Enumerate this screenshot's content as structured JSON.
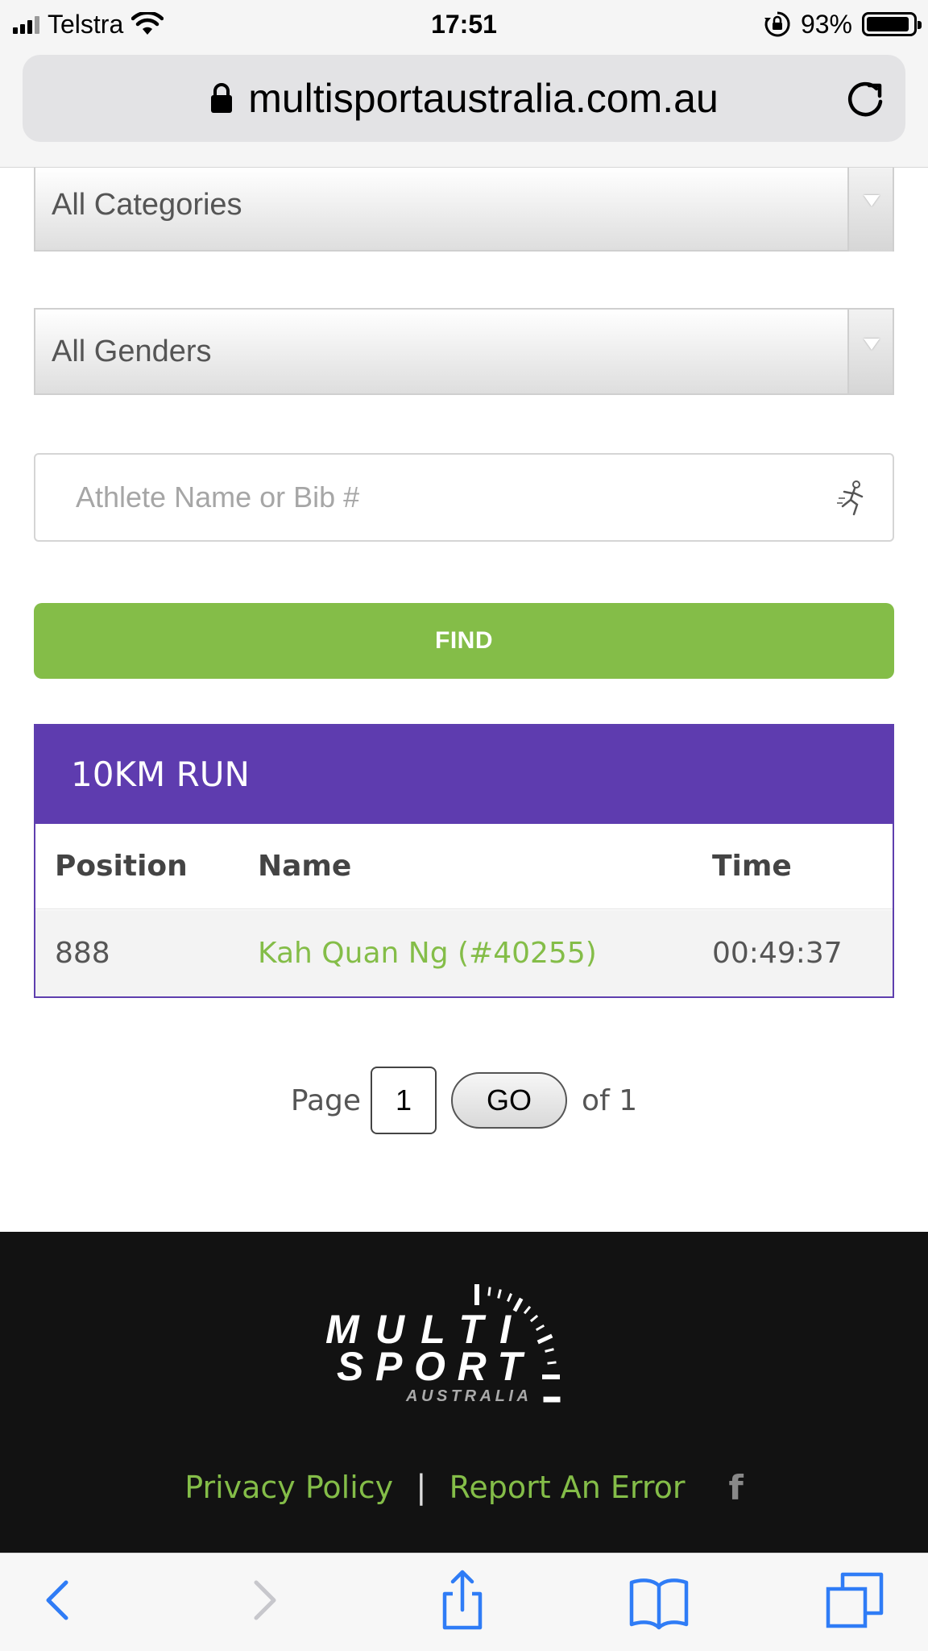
{
  "status_bar": {
    "carrier": "Telstra",
    "time": "17:51",
    "battery": "93%",
    "battery_level": 0.93
  },
  "browser": {
    "url": "multisportaustralia.com.au",
    "icons": [
      "lock-icon",
      "reload-icon"
    ]
  },
  "filters": {
    "category": "All Categories",
    "gender": "All Genders",
    "search_placeholder": "Athlete Name or Bib #",
    "search_value": "",
    "find_label": "FIND"
  },
  "results": {
    "title": "10KM RUN",
    "columns": [
      "Position",
      "Name",
      "Time"
    ],
    "rows": [
      {
        "position": "888",
        "name": "Kah Quan Ng (#40255)",
        "time": "00:49:37"
      }
    ]
  },
  "pager": {
    "prefix": "Page",
    "current": "1",
    "go_label": "GO",
    "suffix": "of 1"
  },
  "footer": {
    "logo_line1": "MULTI",
    "logo_line2": "SPORT",
    "logo_line3": "AUSTRALIA",
    "privacy": "Privacy Policy",
    "separator": "|",
    "report": "Report An Error",
    "facebook": "f"
  },
  "colors": {
    "accent_green": "#84bd48",
    "header_purple": "#5e3caf",
    "footer_bg": "#121212",
    "ios_blue": "#2f7cf6"
  }
}
